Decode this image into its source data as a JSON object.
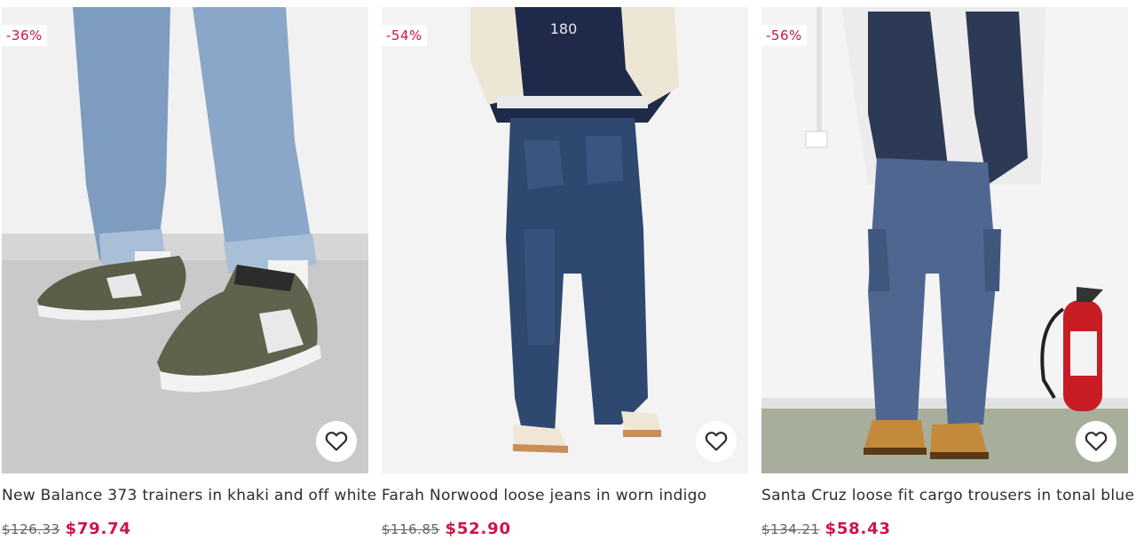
{
  "products": [
    {
      "discount": "-36%",
      "title": "New Balance 373 trainers in khaki and off white",
      "old_price": "$126.33",
      "new_price": "$79.74"
    },
    {
      "discount": "-54%",
      "title": "Farah Norwood loose jeans in worn indigo",
      "old_price": "$116.85",
      "new_price": "$52.90"
    },
    {
      "discount": "-56%",
      "title": "Santa Cruz loose fit cargo trousers in tonal blue print",
      "old_price": "$134.21",
      "new_price": "$58.43"
    }
  ],
  "colors": {
    "sale_red": "#d01345",
    "text": "#2d2d2d",
    "muted": "#666666"
  },
  "icons": {
    "save": "heart-icon"
  }
}
